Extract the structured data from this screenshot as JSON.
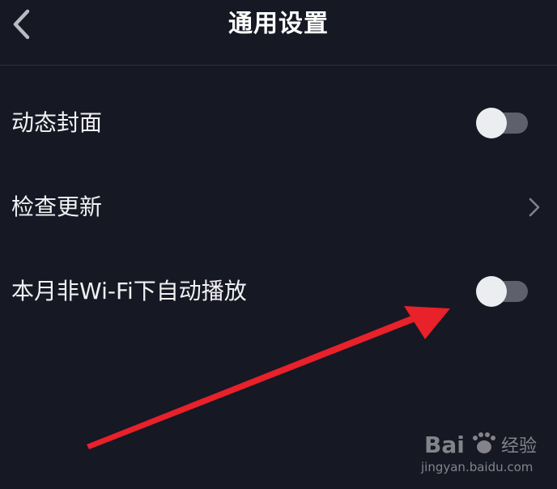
{
  "header": {
    "title": "通用设置",
    "back_icon": "chevron-left-icon"
  },
  "settings": [
    {
      "label": "动态封面",
      "control": "toggle",
      "on": false
    },
    {
      "label": "检查更新",
      "control": "chevron",
      "icon": "chevron-right-icon"
    },
    {
      "label": "本月非Wi-Fi下自动播放",
      "control": "toggle",
      "on": false
    }
  ],
  "annotation": {
    "type": "arrow",
    "color": "#e8212a"
  },
  "watermark": {
    "logo_text": "Bai du 经验",
    "url": "jingyan.baidu.com"
  },
  "colors": {
    "background": "#161824",
    "toggle_off_track": "#5e606b",
    "toggle_knob": "#ecedf0"
  }
}
